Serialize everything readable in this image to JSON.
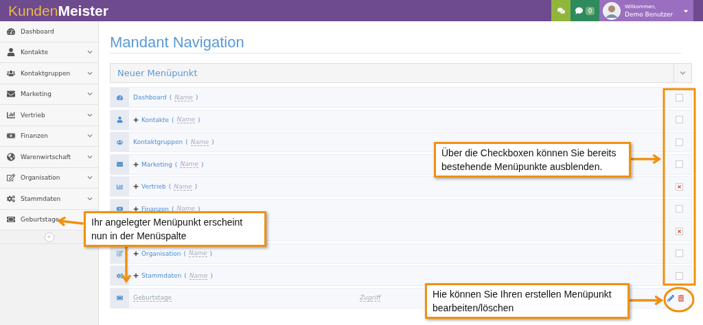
{
  "header": {
    "logo": {
      "first": "Kunden",
      "second": "Meister"
    },
    "notifications_badge": "0",
    "user": {
      "greeting": "Willkommen,",
      "name": "Demo Benutzer"
    }
  },
  "sidebar": {
    "items": [
      {
        "label": "Dashboard",
        "expandable": false
      },
      {
        "label": "Kontakte",
        "expandable": true
      },
      {
        "label": "Kontaktgruppen",
        "expandable": true
      },
      {
        "label": "Marketing",
        "expandable": true
      },
      {
        "label": "Vertrieb",
        "expandable": true
      },
      {
        "label": "Finanzen",
        "expandable": true
      },
      {
        "label": "Warenwirtschaft",
        "expandable": true
      },
      {
        "label": "Organisation",
        "expandable": true
      },
      {
        "label": "Stammdaten",
        "expandable": true
      },
      {
        "label": "Geburtstage"
      }
    ],
    "collapse_button": "«"
  },
  "main": {
    "title": "Mandant Navigation",
    "new_item_select": "Neuer Menüpunkt",
    "rows": [
      {
        "kind": "standard",
        "label": "Dashboard",
        "has_children": false,
        "open": "(",
        "name_placeholder": "Name",
        "close": ")",
        "checked": false
      },
      {
        "kind": "standard",
        "label": "Kontakte",
        "has_children": true,
        "open": "(",
        "name_placeholder": "Name",
        "close": ")",
        "checked": false
      },
      {
        "kind": "standard",
        "label": "Kontaktgruppen",
        "has_children": false,
        "open": "(",
        "name_placeholder": "Name",
        "close": ")",
        "checked": false
      },
      {
        "kind": "standard",
        "label": "Marketing",
        "has_children": true,
        "open": "(",
        "name_placeholder": "Name",
        "close": ")",
        "checked": false
      },
      {
        "kind": "standard",
        "label": "Vertrieb",
        "has_children": true,
        "open": "(",
        "name_placeholder": "Name",
        "close": ")",
        "checked": true
      },
      {
        "kind": "standard",
        "label": "Finanzen",
        "has_children": true,
        "open": "(",
        "name_placeholder": "Name",
        "close": ")",
        "checked": false
      },
      {
        "kind": "hidden",
        "checked": true
      },
      {
        "kind": "standard",
        "label": "Organisation",
        "has_children": true,
        "open": "(",
        "name_placeholder": "Name",
        "close": ")",
        "checked": false
      },
      {
        "kind": "standard",
        "label": "Stammdaten",
        "has_children": true,
        "open": "(",
        "name_placeholder": "Name",
        "close": ")",
        "checked": false
      },
      {
        "kind": "custom",
        "label": "Geburtstage",
        "access": "Zugriff"
      }
    ]
  },
  "callouts": [
    {
      "text": "Über die Checkboxen können Sie bereits bestehende Menüpunkte ausblenden."
    },
    {
      "text": "Ihr angelegter Menüpunkt erscheint nun in der Menüspalte"
    },
    {
      "text": "Hie können Sie Ihren erstellen Menüpunkt bearbeiten/löschen"
    }
  ]
}
